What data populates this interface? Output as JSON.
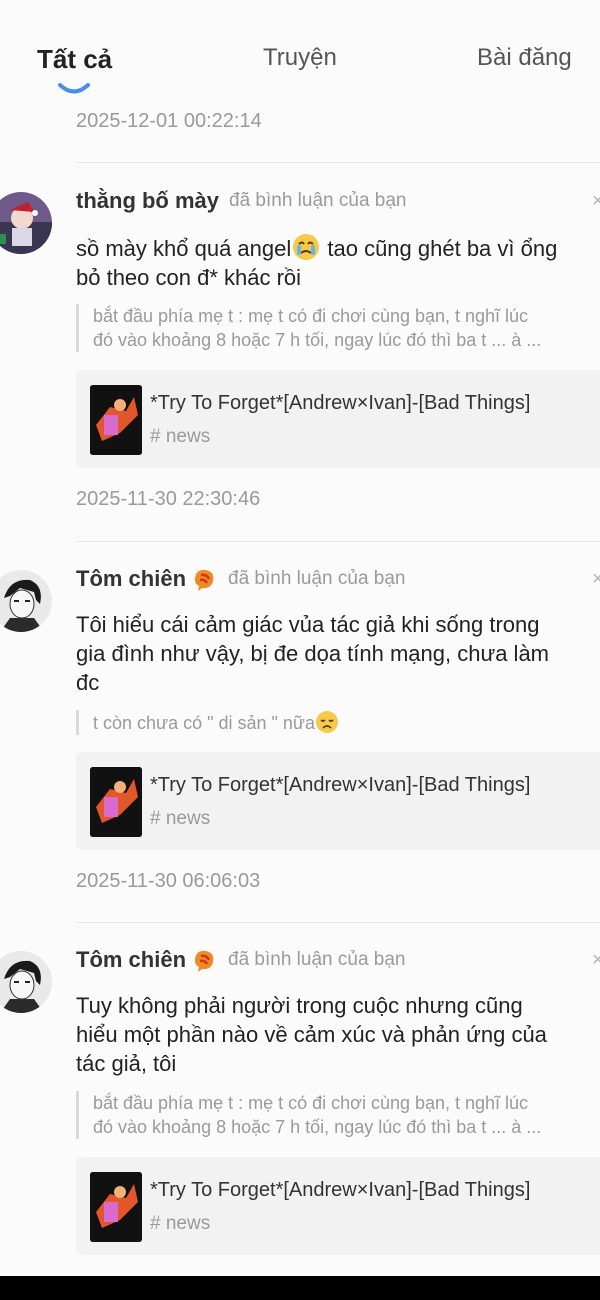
{
  "tabs": [
    {
      "label": "Tất cả"
    },
    {
      "label": "Truyện"
    },
    {
      "label": "Bài đăng"
    }
  ],
  "top_timestamp": "2025-12-01 00:22:14",
  "notifications": [
    {
      "username": "thằng bố mày",
      "action": "đã bình luận của bạn",
      "comment_lines": [
        "sồ mày khổ quá angel",
        " tao cũng ghét ba vì ổng",
        "bỏ theo con đ* khác rồi"
      ],
      "quote_lines": [
        "bắt đầu phía mẹ t : mẹ t có đi chơi cùng bạn, t nghĩ lúc",
        "đó vào khoảng 8 hoặc 7 h tối, ngay lúc đó thì ba t ... à ..."
      ],
      "story_title": "*Try To Forget*[Andrew×Ivan]-[Bad Things]",
      "story_tag": "# news",
      "timestamp": "2025-11-30 22:30:46"
    },
    {
      "username": "Tôm chiên",
      "action": "đã bình luận của bạn",
      "comment_lines": [
        "Tôi hiểu cái cảm giác vủa tác giả khi sống trong",
        "gia đình như vậy, bị đe dọa tính mạng, chưa làm",
        "đc"
      ],
      "quote_text": "t còn chưa có \" di sản \" nữa",
      "story_title": "*Try To Forget*[Andrew×Ivan]-[Bad Things]",
      "story_tag": "# news",
      "timestamp": "2025-11-30 06:06:03"
    },
    {
      "username": "Tôm chiên",
      "action": "đã bình luận của bạn",
      "comment_lines": [
        "Tuy không phải người trong cuộc nhưng cũng",
        "hiểu một phần nào về cảm xúc và phản ứng của",
        "tác giả, tôi"
      ],
      "quote_lines": [
        "bắt đầu phía mẹ t : mẹ t có đi chơi cùng bạn, t nghĩ lúc",
        "đó vào khoảng 8 hoặc 7 h tối, ngay lúc đó thì ba t ... à ..."
      ],
      "story_title": "*Try To Forget*[Andrew×Ivan]-[Bad Things]",
      "story_tag": "# news"
    }
  ],
  "close_label": "×",
  "colors": {
    "accent": "#4a90e2",
    "muted": "#9a9a9a",
    "card_bg": "#f2f2f2"
  },
  "icons": [
    "shrimp-badge-icon",
    "crying-face-emoji",
    "disappointed-face-emoji",
    "close-icon"
  ]
}
